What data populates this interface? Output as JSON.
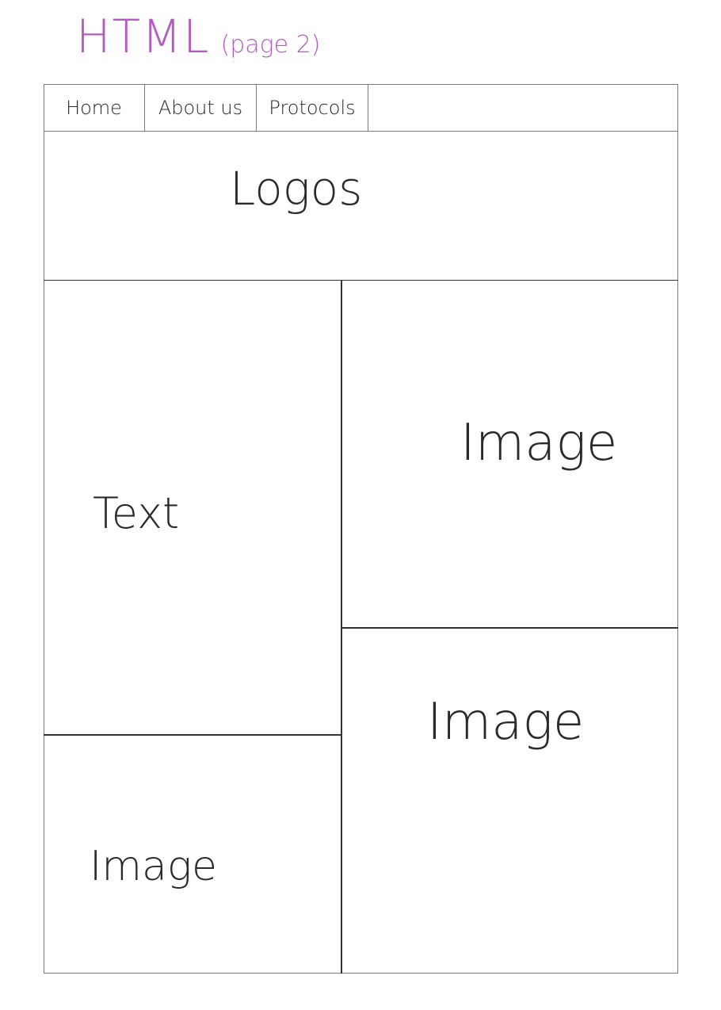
{
  "header": {
    "title": "HTML",
    "subtitle": "(page 2)"
  },
  "nav": {
    "items": [
      {
        "label": "Home"
      },
      {
        "label": "About us"
      },
      {
        "label": "Protocols"
      }
    ]
  },
  "layout": {
    "logos_label": "Logos",
    "text_label": "Text",
    "image_top_right_label": "Image",
    "image_bottom_right_label": "Image",
    "image_bottom_left_label": "Image"
  },
  "colors": {
    "title": "#b45bc3",
    "lines": "#333333"
  }
}
